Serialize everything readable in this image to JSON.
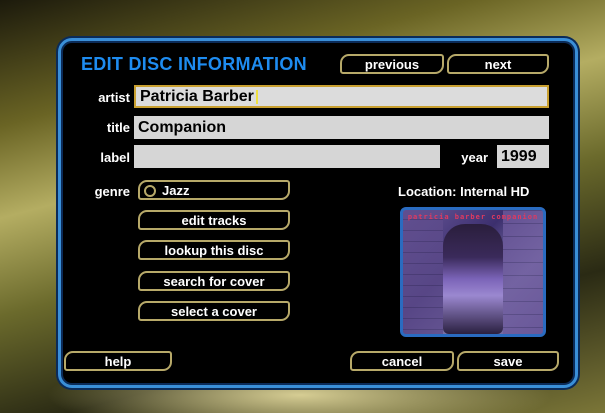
{
  "header": {
    "title": "EDIT DISC INFORMATION",
    "previous_label": "previous",
    "next_label": "next"
  },
  "fields": {
    "artist_label": "artist",
    "artist_value": "Patricia Barber",
    "title_label": "title",
    "title_value": "Companion",
    "label_label": "label",
    "label_value": "",
    "year_label": "year",
    "year_value": "1999",
    "genre_label": "genre",
    "genre_value": "Jazz"
  },
  "actions": {
    "edit_tracks": "edit tracks",
    "lookup_disc": "lookup this disc",
    "search_cover": "search for cover",
    "select_cover": "select a cover"
  },
  "location": "Location: Internal HD",
  "cover": {
    "text": "patricia barber companion"
  },
  "footer": {
    "help_label": "help",
    "cancel_label": "cancel",
    "save_label": "save"
  },
  "colors": {
    "accent": "#1e8cf0",
    "button_border": "#b7a969",
    "field_bg": "#d6d6d6",
    "active_border": "#c9a030"
  }
}
